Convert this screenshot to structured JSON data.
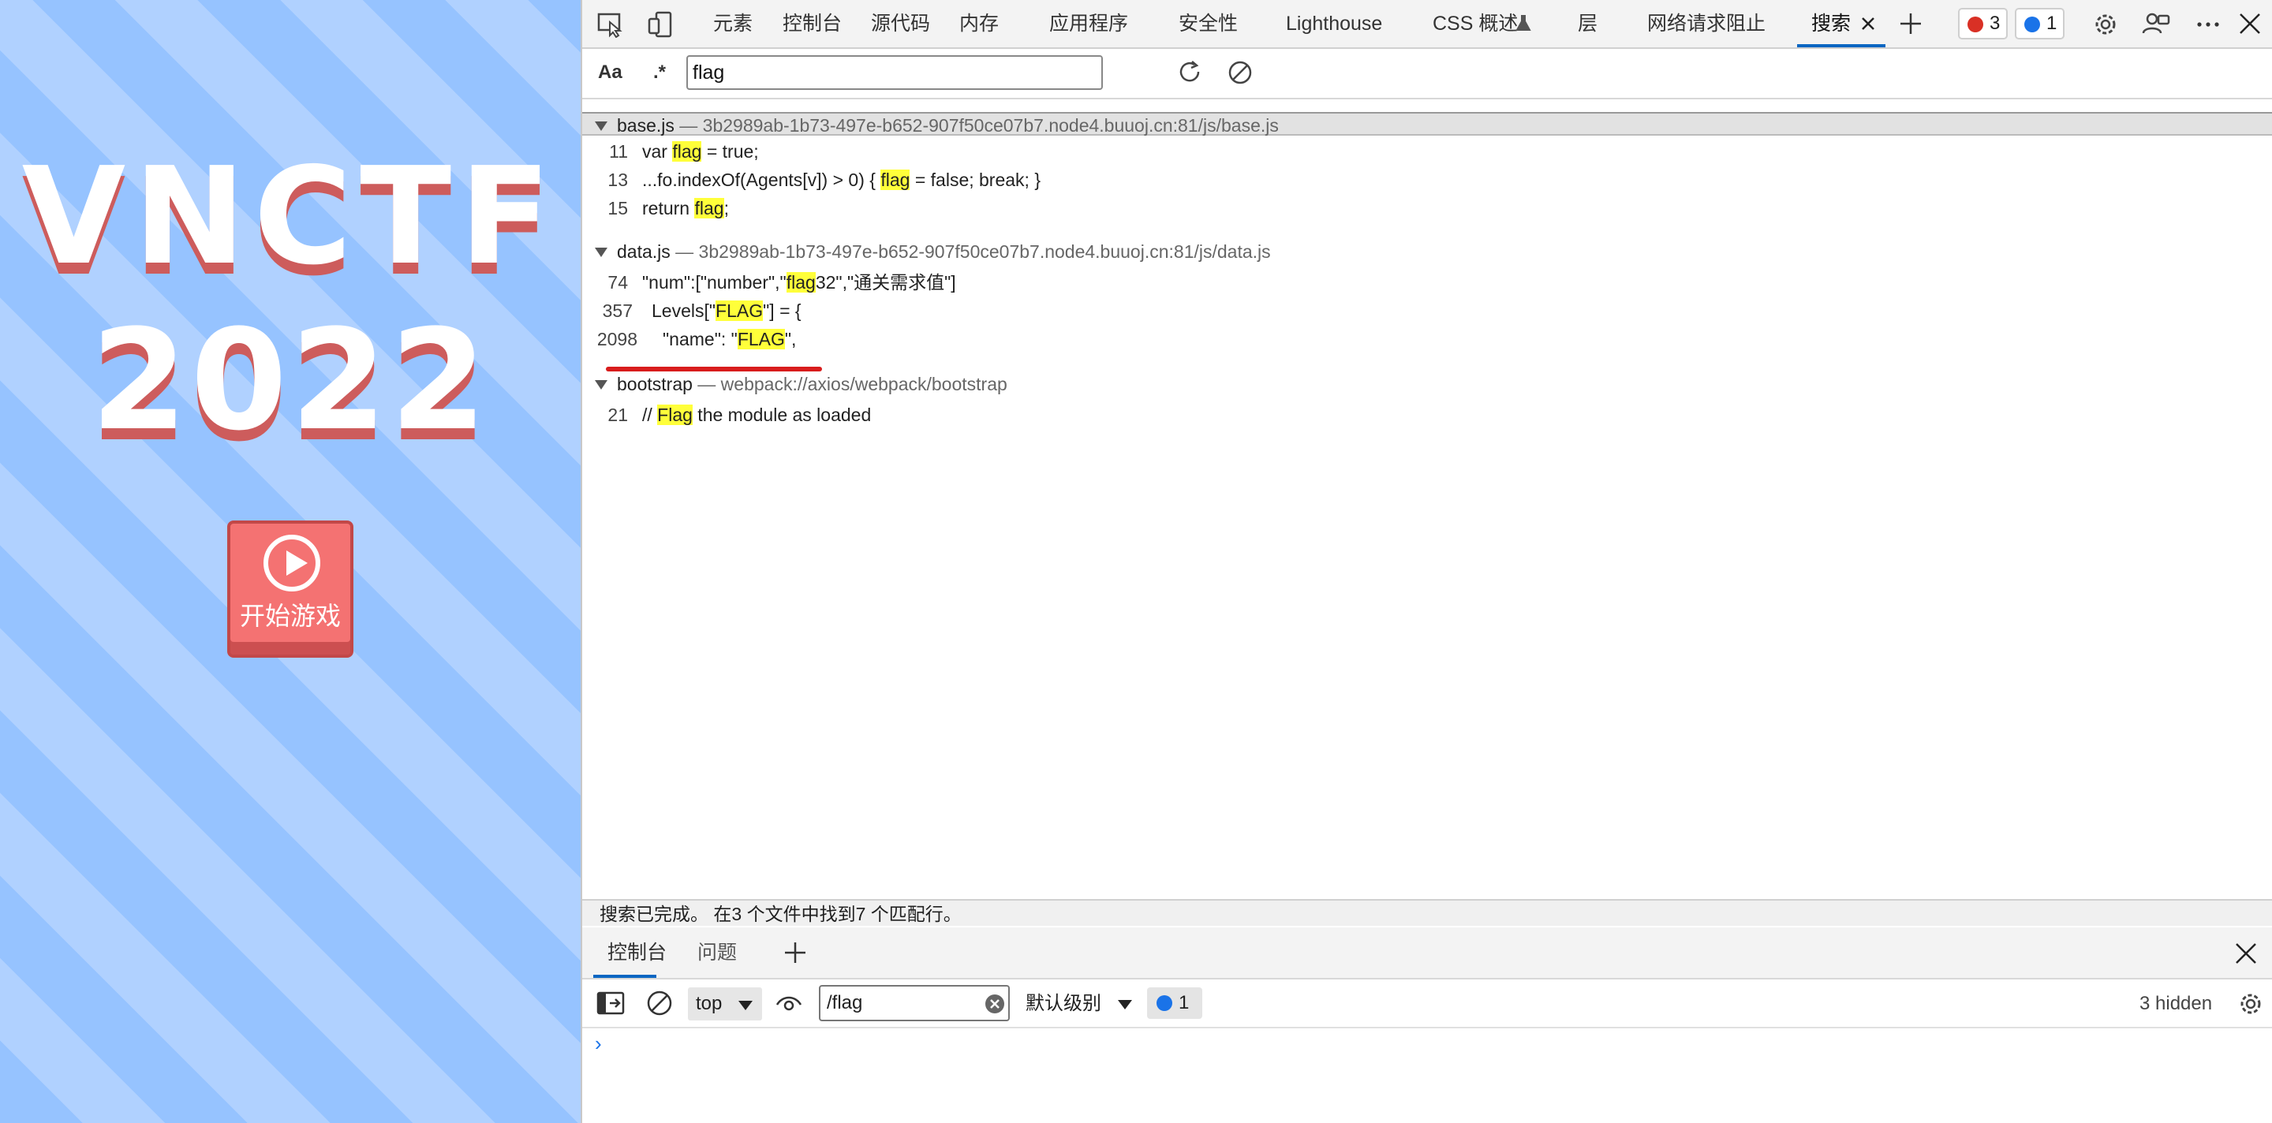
{
  "game": {
    "logo_line1": "VNCTF",
    "logo_line2": "2022",
    "start_label": "开始游戏"
  },
  "devtools": {
    "tabs": [
      "元素",
      "控制台",
      "源代码",
      "内存",
      "应用程序",
      "安全性",
      "Lighthouse",
      "CSS 概述",
      "层",
      "网络请求阻止",
      "搜索"
    ],
    "active_tab": "搜索",
    "errors_count": "3",
    "messages_count": "1",
    "search": {
      "case_label": "Aa",
      "regex_label": ".*",
      "query": "flag"
    },
    "results": [
      {
        "file": "base.js",
        "path": "— 3b2989ab-1b73-497e-b652-907f50ce07b7.node4.buuoj.cn:81/js/base.js",
        "lines": [
          {
            "num": "11",
            "pre": "var ",
            "match": "flag",
            "post": " = true;"
          },
          {
            "num": "13",
            "pre": "...fo.indexOf(Agents[v]) > 0) { ",
            "match": "flag",
            "post": " = false; break; }"
          },
          {
            "num": "15",
            "pre": "return ",
            "match": "flag",
            "post": ";"
          }
        ]
      },
      {
        "file": "data.js",
        "path": "— 3b2989ab-1b73-497e-b652-907f50ce07b7.node4.buuoj.cn:81/js/data.js",
        "lines": [
          {
            "num": "74",
            "pre": "\"num\":[\"number\",\"",
            "match": "flag",
            "post": "32\",\"通关需求值\"]"
          },
          {
            "num": "357",
            "pre": "Levels[\"",
            "match": "FLAG",
            "post": "\"] = {"
          },
          {
            "num": "2098",
            "pre": "\"name\": \"",
            "match": "FLAG",
            "post": "\","
          }
        ]
      },
      {
        "file": "bootstrap",
        "path": "— webpack://axios/webpack/bootstrap",
        "lines": [
          {
            "num": "21",
            "pre": "// ",
            "match": "Flag",
            "post": " the module as loaded"
          }
        ]
      }
    ],
    "status": "搜索已完成。 在3 个文件中找到7 个匹配行。",
    "drawer": {
      "tabs": [
        "控制台",
        "问题"
      ],
      "context": "top",
      "filter_value": "/flag",
      "level": "默认级别",
      "issues_count": "1",
      "hidden_count": "3 hidden",
      "prompt_symbol": "›"
    }
  },
  "colors": {
    "match_highlight": "#ffff3a",
    "accent": "#0a66c2",
    "error_red": "#d93025",
    "info_blue": "#1a73e8",
    "game_stripe_dark": "#96c3ff",
    "game_stripe_light": "#b0d1ff",
    "logo_shadow": "#cd5c5c",
    "button_red": "#f47272"
  }
}
